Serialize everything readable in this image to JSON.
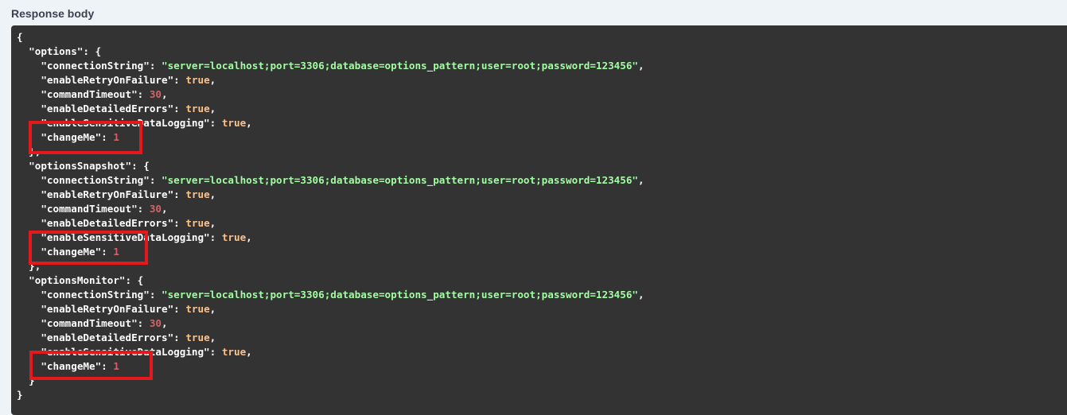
{
  "section_title": "Response body",
  "colors": {
    "key": "#ffffff",
    "string": "#a2fca2",
    "boolean": "#fcc28c",
    "number": "#d36363",
    "panel_background": "#333333",
    "highlight_box": "#e3191e"
  },
  "response_body": {
    "open_brace": "{",
    "close_brace": "}",
    "sections": [
      {
        "name": "\"options\"",
        "open": ": {",
        "close": "},",
        "props": [
          {
            "key": "\"connectionString\"",
            "value": "\"server=localhost;port=3306;database=options_pattern;user=root;password=123456\"",
            "type": "str",
            "sep": ","
          },
          {
            "key": "\"enableRetryOnFailure\"",
            "value": "true",
            "type": "bool",
            "sep": ","
          },
          {
            "key": "\"commandTimeout\"",
            "value": "30",
            "type": "num",
            "sep": ","
          },
          {
            "key": "\"enableDetailedErrors\"",
            "value": "true",
            "type": "bool",
            "sep": ","
          },
          {
            "key": "\"enableSensitiveDataLogging\"",
            "value": "true",
            "type": "bool",
            "sep": ","
          },
          {
            "key": "\"changeMe\"",
            "value": "1",
            "type": "num",
            "sep": ""
          }
        ]
      },
      {
        "name": "\"optionsSnapshot\"",
        "open": ": {",
        "close": "},",
        "props": [
          {
            "key": "\"connectionString\"",
            "value": "\"server=localhost;port=3306;database=options_pattern;user=root;password=123456\"",
            "type": "str",
            "sep": ","
          },
          {
            "key": "\"enableRetryOnFailure\"",
            "value": "true",
            "type": "bool",
            "sep": ","
          },
          {
            "key": "\"commandTimeout\"",
            "value": "30",
            "type": "num",
            "sep": ","
          },
          {
            "key": "\"enableDetailedErrors\"",
            "value": "true",
            "type": "bool",
            "sep": ","
          },
          {
            "key": "\"enableSensitiveDataLogging\"",
            "value": "true",
            "type": "bool",
            "sep": ","
          },
          {
            "key": "\"changeMe\"",
            "value": "1",
            "type": "num",
            "sep": ""
          }
        ]
      },
      {
        "name": "\"optionsMonitor\"",
        "open": ": {",
        "close": "}",
        "props": [
          {
            "key": "\"connectionString\"",
            "value": "\"server=localhost;port=3306;database=options_pattern;user=root;password=123456\"",
            "type": "str",
            "sep": ","
          },
          {
            "key": "\"enableRetryOnFailure\"",
            "value": "true",
            "type": "bool",
            "sep": ","
          },
          {
            "key": "\"commandTimeout\"",
            "value": "30",
            "type": "num",
            "sep": ","
          },
          {
            "key": "\"enableDetailedErrors\"",
            "value": "true",
            "type": "bool",
            "sep": ","
          },
          {
            "key": "\"enableSensitiveDataLogging\"",
            "value": "true",
            "type": "bool",
            "sep": ","
          },
          {
            "key": "\"changeMe\"",
            "value": "1",
            "type": "num",
            "sep": ""
          }
        ]
      }
    ]
  }
}
